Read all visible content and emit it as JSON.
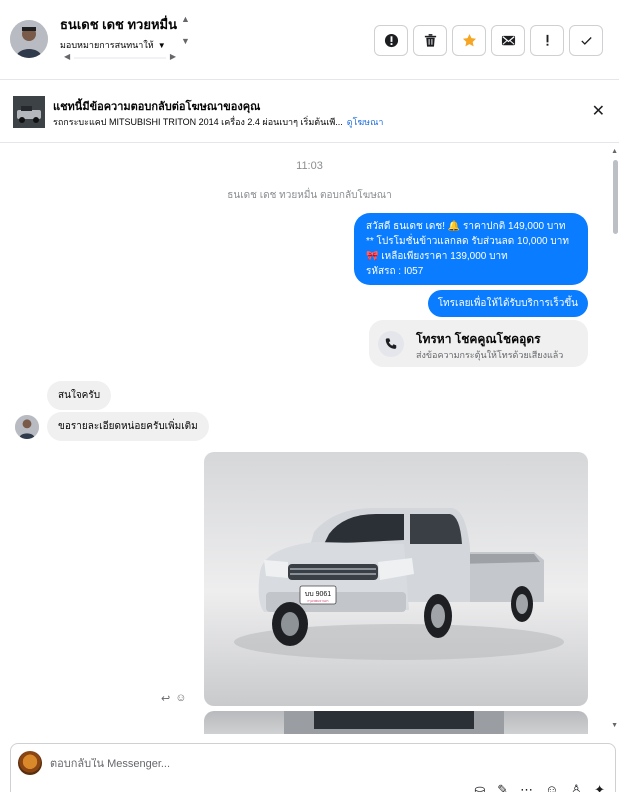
{
  "header": {
    "contact_name": "ธนเดช เดช ทวยหมื่น",
    "assign_label": "มอบหมายการสนทนาให้",
    "actions": [
      {
        "name": "mark-spam-button",
        "icon": "alert-circle-icon"
      },
      {
        "name": "delete-button",
        "icon": "trash-icon"
      },
      {
        "name": "star-button",
        "icon": "star-icon"
      },
      {
        "name": "mark-unread-button",
        "icon": "envelope-icon"
      },
      {
        "name": "follow-up-button",
        "icon": "exclamation-icon"
      },
      {
        "name": "mark-done-button",
        "icon": "check-icon"
      }
    ]
  },
  "ad_banner": {
    "title": "แชทนี้มีข้อความตอบกลับต่อโฆษณาของคุณ",
    "description": "รถกระบะแคป MITSUBISHI TRITON 2014 เครื่อง 2.4 ผ่อนเบาๆ เริ่มต้นเพี...",
    "link": "ดูโฆษณา",
    "close_icon": "close-icon"
  },
  "chat": {
    "timestamp": "11:03",
    "reply_note": "ธนเดช เดช ทวยหมื่น ตอบกลับโฆษณา",
    "outgoing": {
      "promo_lines": [
        "สวัสดี ธนเดช เดช! 🔔 ราคาปกติ 149,000 บาท",
        "** โปรโมชั่นข้าวแลกลด รับส่วนลด 10,000 บาท",
        "🎀  เหลือเพียงราคา 139,000 บาท",
        "รหัสรถ : I057"
      ],
      "cta": "โทรเลยเพื่อให้ได้รับบริการเร็วขึ้น"
    },
    "call_card": {
      "title": "โทรหา โชคคูณโชคอุดร",
      "subtitle": "ส่งข้อความกระตุ้นให้โทรด้วยเสียงแล้ว"
    },
    "incoming": [
      "สนใจครับ",
      "ขอรายละเอียดหน่อยครับเพิ่มเติม"
    ],
    "photo": {
      "plate": "บบ 9061",
      "plate_province": "กรุงเทพมหานคร"
    }
  },
  "composer": {
    "placeholder": "ตอบกลับใน Messenger...",
    "tools": [
      "bag-icon",
      "paperclip-icon",
      "more-icon",
      "emoji-icon",
      "thumb-icon",
      "sparkle-icon"
    ]
  }
}
